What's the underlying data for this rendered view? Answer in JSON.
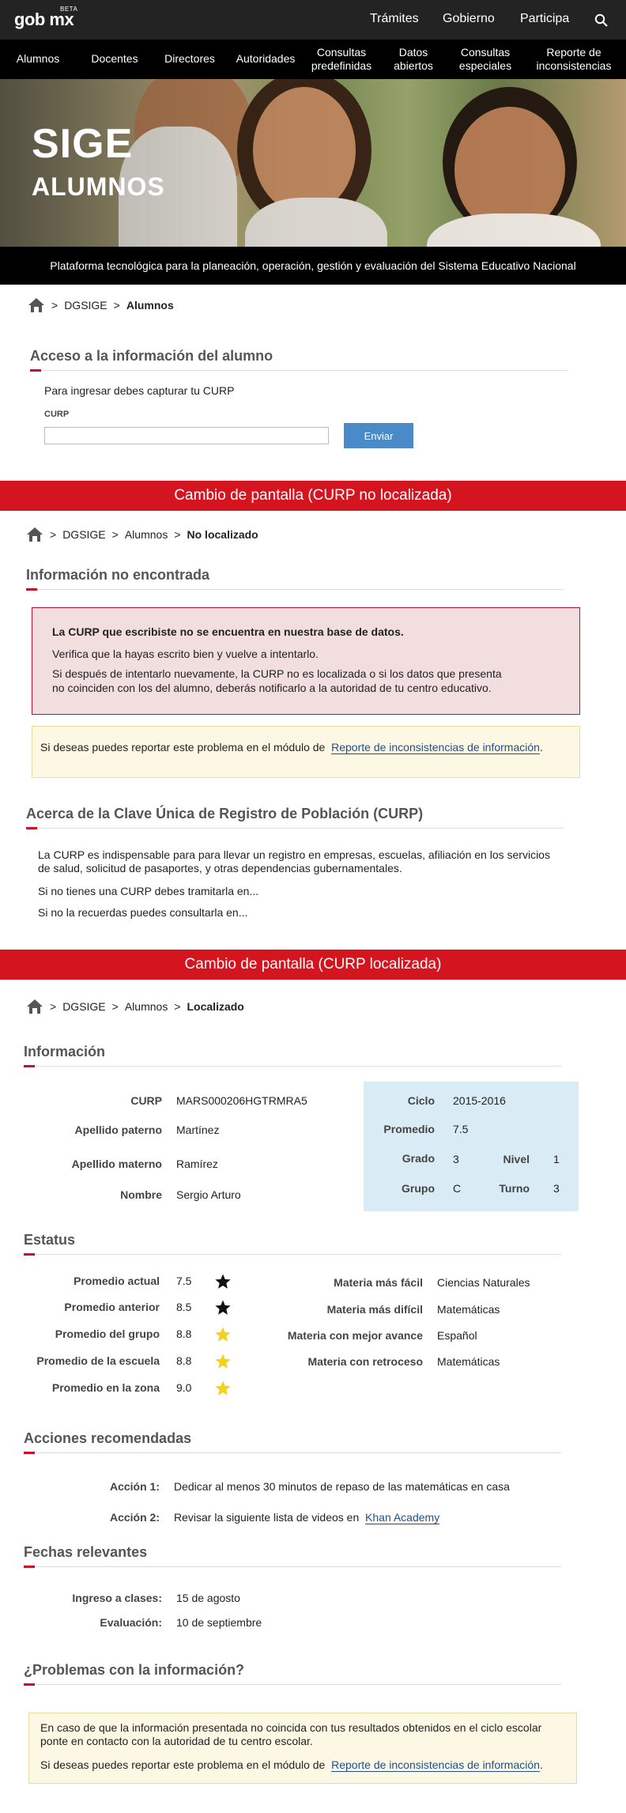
{
  "topbar": {
    "logo": "gob mx",
    "beta": "BETA",
    "nav": [
      "Trámites",
      "Gobierno",
      "Participa"
    ],
    "search_icon": "search-icon"
  },
  "menu": [
    {
      "l1": "Alumnos",
      "l2": ""
    },
    {
      "l1": "Docentes",
      "l2": ""
    },
    {
      "l1": "Directores",
      "l2": ""
    },
    {
      "l1": "Autoridades",
      "l2": ""
    },
    {
      "l1": "Consultas",
      "l2": "predefinidas"
    },
    {
      "l1": "Datos",
      "l2": "abiertos"
    },
    {
      "l1": "Consultas",
      "l2": "especiales"
    },
    {
      "l1": "Reporte de",
      "l2": "inconsistencias"
    }
  ],
  "hero": {
    "brand": "SIGE",
    "subtitle": "ALUMNOS"
  },
  "tagline": "Plataforma tecnológica para la planeación, operación, gestión y evaluación del Sistema Educativo Nacional",
  "screen1": {
    "breadcrumb": [
      "DGSIGE",
      "Alumnos"
    ],
    "title": "Acceso a la información del alumno",
    "instructions": "Para ingresar debes capturar tu CURP",
    "curp_label": "CURP",
    "curp_value": "",
    "submit": "Enviar"
  },
  "band_not_found": "Cambio de pantalla (CURP no localizada)",
  "screen2": {
    "breadcrumb": [
      "DGSIGE",
      "Alumnos",
      "No localizado"
    ],
    "title": "Información no encontrada",
    "alert_bold": "La CURP que escribiste no se encuentra en nuestra base de datos.",
    "alert_line2": "Verifica que la hayas escrito bien y vuelve a intentarlo.",
    "alert_line3a": "Si después de intentarlo nuevamente, la CURP no es localizada o si los datos que presenta",
    "alert_line3b": "no coinciden con los del alumno, deberás notificarlo a la autoridad de tu centro educativo.",
    "report_text": "Si deseas puedes reportar este problema en el módulo de",
    "report_link": "Reporte de inconsistencias de información",
    "about_title": "Acerca de la Clave Única de Registro de Población (CURP)",
    "about_p1a": "La CURP es indispensable para  para llevar un registro en empresas, escuelas, afiliación en los servicios",
    "about_p1b": "de salud, solicitud de pasaportes, y otras dependencias gubernamentales.",
    "about_p2": "Si no tienes una CURP debes tramitarla en...",
    "about_p3": "Si no la recuerdas puedes consultarla en..."
  },
  "band_found": "Cambio de pantalla (CURP localizada)",
  "screen3": {
    "breadcrumb": [
      "DGSIGE",
      "Alumnos",
      "Localizado"
    ],
    "info_title": "Información",
    "info": {
      "curp_l": "CURP",
      "curp": "MARS000206HGTRMRA5",
      "ap_l": "Apellido paterno",
      "ap": "Martínez",
      "am_l": "Apellido materno",
      "am": "Ramírez",
      "nombre_l": "Nombre",
      "nombre": "Sergio Arturo",
      "ciclo_l": "Ciclo",
      "ciclo": "2015-2016",
      "promedio_l": "Promedio",
      "promedio": "7.5",
      "grado_l": "Grado",
      "grado": "3",
      "nivel_l": "Nivel",
      "nivel": "1",
      "grupo_l": "Grupo",
      "grupo": "C",
      "turno_l": "Turno",
      "turno": "3"
    },
    "estatus_title": "Estatus",
    "estatus": [
      {
        "label": "Promedio actual",
        "value": "7.5",
        "star": "black"
      },
      {
        "label": "Promedio anterior",
        "value": "8.5",
        "star": "black"
      },
      {
        "label": "Promedio del grupo",
        "value": "8.8",
        "star": "yellow"
      },
      {
        "label": "Promedio de la escuela",
        "value": "8.8",
        "star": "yellow"
      },
      {
        "label": "Promedio en la zona",
        "value": "9.0",
        "star": "yellow"
      }
    ],
    "materias": [
      {
        "label": "Materia más fácil",
        "value": "Ciencias Naturales"
      },
      {
        "label": "Materia más difícil",
        "value": "Matemáticas"
      },
      {
        "label": "Materia con mejor avance",
        "value": "Español"
      },
      {
        "label": "Materia con retroceso",
        "value": "Matemáticas"
      }
    ],
    "acciones_title": "Acciones recomendadas",
    "accion1_l": "Acción 1:",
    "accion1": "Dedicar al menos 30 minutos de repaso de las matemáticas en casa",
    "accion2_l": "Acción 2:",
    "accion2": "Revisar la siguiente lista de videos en",
    "accion2_link": "Khan Academy",
    "fechas_title": "Fechas relevantes",
    "ingreso_l": "Ingreso a clases:",
    "ingreso": "15 de agosto",
    "evaluacion_l": "Evaluación:",
    "evaluacion": "10 de septiembre",
    "problemas_title": "¿Problemas con la información?",
    "prob_p1a": "En caso de que la información presentada no coincida con tus resultados obtenidos en el ciclo escolar",
    "prob_p1b": "ponte en contacto con la autoridad de tu centro escolar.",
    "prob_p2": "Si deseas puedes reportar este problema en el módulo de",
    "prob_link": "Reporte de inconsistencias de información"
  },
  "colors": {
    "accent_red": "#c8102e",
    "band_red": "#d4141e",
    "button_blue": "#4a8ac9",
    "info_blue": "#d9ebf5",
    "star_yellow": "#f2d21c"
  }
}
